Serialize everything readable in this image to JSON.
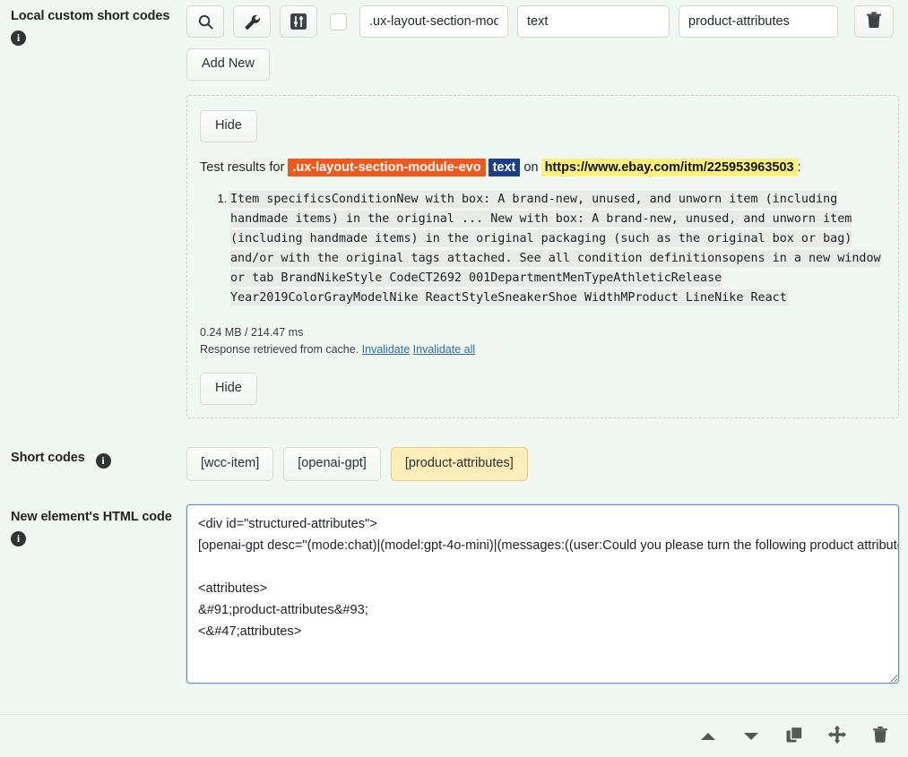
{
  "local_short_codes": {
    "label": "Local custom short codes",
    "info_icon": "info-icon",
    "buttons": [
      {
        "name": "search-icon",
        "title": "Search"
      },
      {
        "name": "wrench-icon",
        "title": "Settings"
      },
      {
        "name": "sliders-icon",
        "title": "Adjust"
      }
    ],
    "checkbox_checked": false,
    "fields": {
      "selector": {
        "value": ".ux-layout-section-module-evo",
        "placeholder": "selector"
      },
      "type": {
        "value": "text",
        "placeholder": "type"
      },
      "name": {
        "value": "product-attributes",
        "placeholder": "name"
      }
    },
    "delete_icon": "trash-icon",
    "add_new_label": "Add New"
  },
  "results_panel": {
    "hide_top_label": "Hide",
    "hide_bottom_label": "Hide",
    "title_prefix": "Test results for",
    "title_selector": ".ux-layout-section-module-evo",
    "title_type": "text",
    "title_on": "on",
    "title_url": "https://www.ebay.com/itm/225953963503",
    "title_suffix": ":",
    "items": [
      "Item specificsConditionNew with box: A brand-new, unused, and unworn item (including handmade items) in the original ... New with box: A brand-new, unused, and unworn item (including handmade items) in the original packaging (such as the original box or bag) and/or with the original tags attached. See all condition definitionsopens in a new window or tab BrandNikeStyle CodeCT2692 001DepartmentMenTypeAthleticRelease Year2019ColorGrayModelNike ReactStyleSneakerShoe WidthMProduct LineNike React"
    ],
    "size_time": "0.24 MB / 214.47 ms",
    "cache_text": "Response retrieved from cache.",
    "invalidate_label": "Invalidate",
    "invalidate_all_label": "Invalidate all"
  },
  "short_codes": {
    "label": "Short codes",
    "info_icon": "info-icon",
    "codes": [
      {
        "label": "[wcc-item]",
        "active": false
      },
      {
        "label": "[openai-gpt]",
        "active": false
      },
      {
        "label": "[product-attributes]",
        "active": true
      }
    ]
  },
  "html_code": {
    "label": "New element's HTML code",
    "info_icon": "info-icon",
    "value": "<div id=\"structured-attributes\">\n[openai-gpt desc=\"(mode:chat)|(model:gpt-4o-mini)|(messages:((user:Could you please turn the following product attributes into JSON, in the specified structure below.\n\n<attributes>\n&#91;product-attributes&#93;\n<&#47;attributes>",
    "placeholder": "Enter HTML code"
  },
  "footer": {
    "actions": [
      {
        "name": "move-up-button",
        "icon": "caret-up-icon"
      },
      {
        "name": "move-down-button",
        "icon": "caret-down-icon"
      },
      {
        "name": "duplicate-button",
        "icon": "copy-icon"
      },
      {
        "name": "drag-move-button",
        "icon": "move-icon"
      },
      {
        "name": "delete-button",
        "icon": "trash-icon"
      }
    ]
  },
  "colors": {
    "page_bg": "#f1f7f1",
    "selector_highlight": "#f1581c",
    "type_badge": "#1b3f8b",
    "url_highlight": "#fcf07a",
    "active_shortcode": "#fdedb8",
    "focus_border": "#5b8bbf",
    "link": "#2e6da4"
  }
}
